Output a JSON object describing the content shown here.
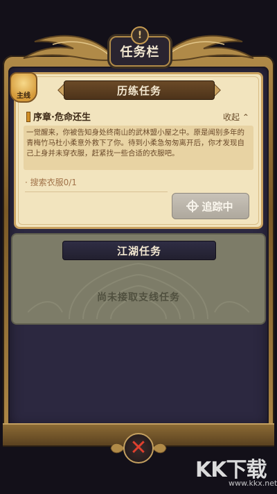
{
  "header": {
    "title": "任务栏",
    "alert_icon": "exclamation-icon"
  },
  "main_quest": {
    "badge": "主线",
    "section_title": "历练任务",
    "quest_title": "序章·危命还生",
    "collapse_label": "收起",
    "description": "一觉醒来，你被告知身处终南山的武林盟小屋之中。原是闻别多年的青梅竹马杜小柔意外救下了你。待到小柔急匆匆离开后，你才发现自己上身并未穿衣服，赶紧找一些合适的衣服吧。",
    "objective": "· 搜索衣服0/1",
    "track_button": "追踪中",
    "track_icon": "crosshair-icon"
  },
  "side_quest": {
    "section_title": "江湖任务",
    "empty_text": "尚未接取支线任务"
  },
  "footer": {
    "close_icon": "close-icon"
  },
  "watermark": {
    "text": "KK下载",
    "sub": "www.kkx.net"
  },
  "colors": {
    "frame_gold": "#b08a48",
    "panel_parchment": "#f2e4be",
    "panel_side": "#7d7c68",
    "close_red": "#e0402e",
    "background": "#131019"
  }
}
